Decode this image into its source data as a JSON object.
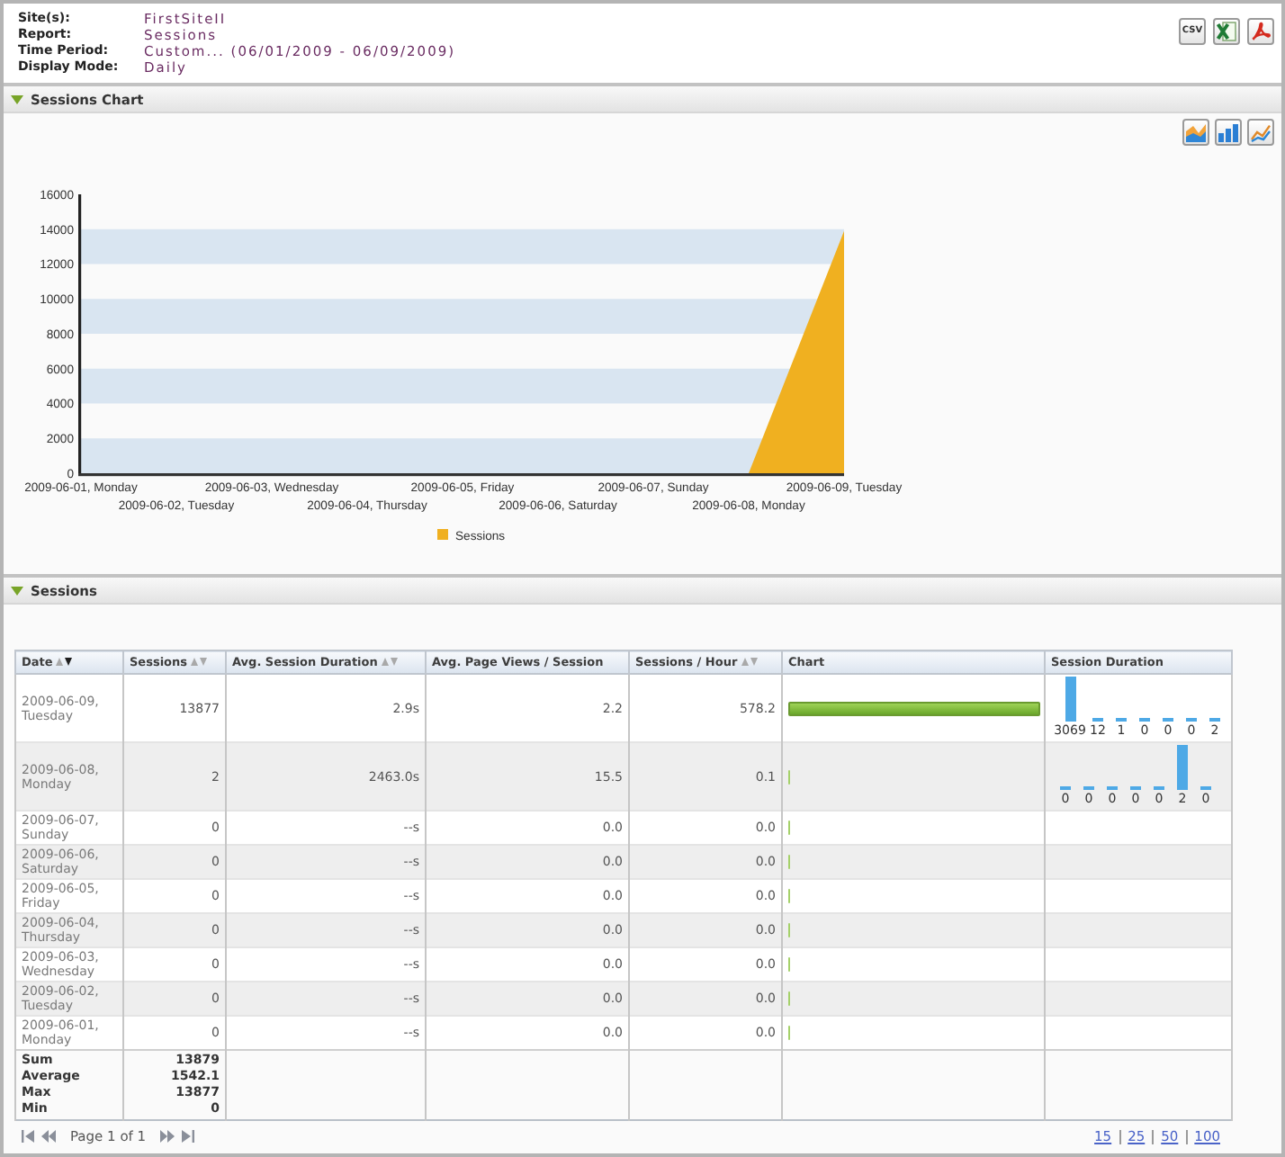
{
  "report_info": [
    {
      "label": "Site(s):",
      "value": "FirstSiteII"
    },
    {
      "label": "Report:",
      "value": "Sessions"
    },
    {
      "label": "Time Period:",
      "value": "Custom... (06/01/2009 - 06/09/2009)"
    },
    {
      "label": "Display Mode:",
      "value": "Daily"
    }
  ],
  "export_buttons": [
    {
      "kind": "csv",
      "label": "CSV"
    },
    {
      "kind": "spreadsheet"
    },
    {
      "kind": "pdf"
    }
  ],
  "chart_section": {
    "title": "Sessions Chart",
    "expanded": true,
    "view_buttons": [
      {
        "kind": "area"
      },
      {
        "kind": "bar"
      },
      {
        "kind": "line"
      }
    ],
    "chart_data": {
      "type": "area",
      "categories": [
        "2009-06-01, Monday",
        "2009-06-02, Tuesday",
        "2009-06-03, Wednesday",
        "2009-06-04, Thursday",
        "2009-06-05, Friday",
        "2009-06-06, Saturday",
        "2009-06-07, Sunday",
        "2009-06-08, Monday",
        "2009-06-09, Tuesday"
      ],
      "series": [
        {
          "name": "Sessions",
          "color": "#f0b020",
          "values": [
            0,
            0,
            0,
            0,
            0,
            0,
            0,
            0,
            13900
          ]
        }
      ],
      "ylim": [
        0,
        16000
      ],
      "yticks": [
        0,
        2000,
        4000,
        6000,
        8000,
        10000,
        12000,
        14000,
        16000
      ]
    }
  },
  "table_section": {
    "title": "Sessions",
    "expanded": true,
    "columns": [
      {
        "label": "Date",
        "sortable": true,
        "sorted_descending": true
      },
      {
        "label": "Sessions",
        "sortable": true,
        "sorted_descending": false
      },
      {
        "label": "Avg. Session Duration",
        "sortable": true,
        "sorted_descending": false
      },
      {
        "label": "Avg. Page Views / Session",
        "sortable": false,
        "sorted_descending": false
      },
      {
        "label": "Sessions / Hour",
        "sortable": true,
        "sorted_descending": false
      },
      {
        "label": "Chart",
        "sortable": false,
        "sorted_descending": false
      },
      {
        "label": "Session Duration",
        "sortable": false,
        "sorted_descending": false
      }
    ],
    "rows": [
      {
        "date": "2009-06-09, Tuesday",
        "sessions": "13877",
        "avg_session_duration": "2.9s",
        "avg_page_views": "2.2",
        "sessions_per_hour": "578.2",
        "level": 1,
        "duration_counts": [
          "3069",
          "12",
          "1",
          "0",
          "0",
          "0",
          "2"
        ]
      },
      {
        "date": "2009-06-08, Monday",
        "sessions": "2",
        "avg_session_duration": "2463.0s",
        "avg_page_views": "15.5",
        "sessions_per_hour": "0.1",
        "level": 0.0002,
        "duration_counts": [
          "0",
          "0",
          "0",
          "0",
          "0",
          "2",
          "0"
        ]
      },
      {
        "date": "2009-06-07, Sunday",
        "sessions": "0",
        "avg_session_duration": "--s",
        "avg_page_views": "0.0",
        "sessions_per_hour": "0.0",
        "level": 0
      },
      {
        "date": "2009-06-06, Saturday",
        "sessions": "0",
        "avg_session_duration": "--s",
        "avg_page_views": "0.0",
        "sessions_per_hour": "0.0",
        "level": 0
      },
      {
        "date": "2009-06-05, Friday",
        "sessions": "0",
        "avg_session_duration": "--s",
        "avg_page_views": "0.0",
        "sessions_per_hour": "0.0",
        "level": 0
      },
      {
        "date": "2009-06-04, Thursday",
        "sessions": "0",
        "avg_session_duration": "--s",
        "avg_page_views": "0.0",
        "sessions_per_hour": "0.0",
        "level": 0
      },
      {
        "date": "2009-06-03, Wednesday",
        "sessions": "0",
        "avg_session_duration": "--s",
        "avg_page_views": "0.0",
        "sessions_per_hour": "0.0",
        "level": 0
      },
      {
        "date": "2009-06-02, Tuesday",
        "sessions": "0",
        "avg_session_duration": "--s",
        "avg_page_views": "0.0",
        "sessions_per_hour": "0.0",
        "level": 0
      },
      {
        "date": "2009-06-01, Monday",
        "sessions": "0",
        "avg_session_duration": "--s",
        "avg_page_views": "0.0",
        "sessions_per_hour": "0.0",
        "level": 0
      }
    ],
    "summary": [
      {
        "label": "Sum",
        "value": "13879"
      },
      {
        "label": "Average",
        "value": "1542.1"
      },
      {
        "label": "Max",
        "value": "13877"
      },
      {
        "label": "Min",
        "value": "0"
      }
    ],
    "pagination": {
      "page_text": "Page 1 of 1",
      "page_sizes": [
        "15",
        "25",
        "50",
        "100"
      ]
    }
  }
}
